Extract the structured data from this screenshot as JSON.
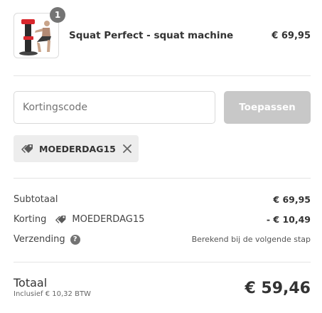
{
  "product": {
    "quantity": "1",
    "name": "Squat Perfect - squat machine",
    "price": "€ 69,95"
  },
  "discount": {
    "placeholder": "Kortingscode",
    "apply_label": "Toepassen",
    "applied_code": "MOEDERDAG15"
  },
  "summary": {
    "subtotal_label": "Subtotaal",
    "subtotal_value": "€ 69,95",
    "discount_label": "Korting",
    "discount_code": "MOEDERDAG15",
    "discount_value": "- € 10,49",
    "shipping_label": "Verzending",
    "shipping_help": "?",
    "shipping_value": "Berekend bij de volgende stap"
  },
  "total": {
    "label": "Totaal",
    "tax_note": "Inclusief € 10,32 BTW",
    "amount": "€ 59,46"
  },
  "colors": {
    "apply_button": "#c8c8c8",
    "tag_background": "#ededed",
    "badge": "#747474"
  }
}
